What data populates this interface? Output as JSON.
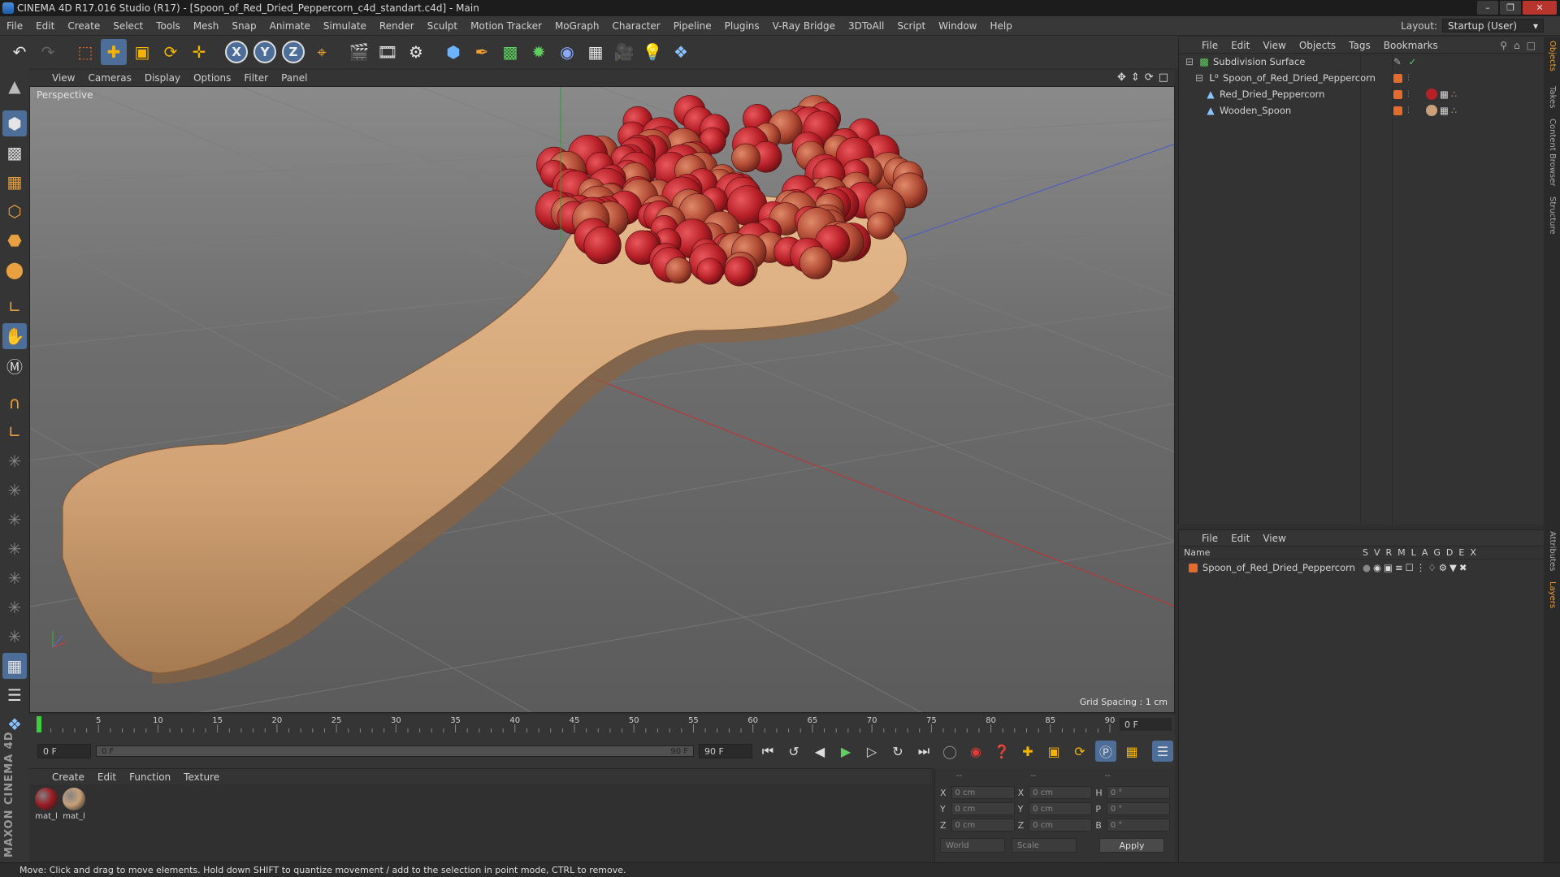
{
  "window": {
    "title": "CINEMA 4D R17.016 Studio (R17) - [Spoon_of_Red_Dried_Peppercorn_c4d_standart.c4d] - Main"
  },
  "menubar": {
    "items": [
      "File",
      "Edit",
      "Create",
      "Select",
      "Tools",
      "Mesh",
      "Snap",
      "Animate",
      "Simulate",
      "Render",
      "Sculpt",
      "Motion Tracker",
      "MoGraph",
      "Character",
      "Pipeline",
      "Plugins",
      "V-Ray Bridge",
      "3DToAll",
      "Script",
      "Window",
      "Help"
    ],
    "layout_label": "Layout:",
    "layout_value": "Startup (User)"
  },
  "toolbar": {
    "axis_x": "X",
    "axis_y": "Y",
    "axis_z": "Z"
  },
  "viewport": {
    "menu": [
      "View",
      "Cameras",
      "Display",
      "Options",
      "Filter",
      "Panel"
    ],
    "camera_label": "Perspective",
    "grid_spacing": "Grid Spacing : 1 cm",
    "colors": {
      "spoon": "#d4a578",
      "peppercorn": "#c42a30",
      "grid_bg": "#6e6e6e"
    }
  },
  "timeline": {
    "ticks": [
      "0",
      "5",
      "10",
      "15",
      "20",
      "25",
      "30",
      "35",
      "40",
      "45",
      "50",
      "55",
      "60",
      "65",
      "70",
      "75",
      "80",
      "85",
      "90"
    ],
    "current_frame": "0 F"
  },
  "playbar": {
    "start_field": "0 F",
    "slider_start": "0 F",
    "slider_end": "90 F",
    "end_field": "90 F"
  },
  "materials": {
    "menu": [
      "Create",
      "Edit",
      "Function",
      "Texture"
    ],
    "items": [
      {
        "label": "mat_l",
        "color": "#9a1c22"
      },
      {
        "label": "mat_l",
        "color": "#c9a07a"
      }
    ]
  },
  "coordinates": {
    "header": [
      "--",
      "--",
      "--"
    ],
    "rows": [
      {
        "a1": "X",
        "v1": "0 cm",
        "a2": "X",
        "v2": "0 cm",
        "a3": "H",
        "v3": "0 °"
      },
      {
        "a1": "Y",
        "v1": "0 cm",
        "a2": "Y",
        "v2": "0 cm",
        "a3": "P",
        "v3": "0 °"
      },
      {
        "a1": "Z",
        "v1": "0 cm",
        "a2": "Z",
        "v2": "0 cm",
        "a3": "B",
        "v3": "0 °"
      }
    ],
    "mode": "World",
    "transform": "Scale",
    "apply_label": "Apply"
  },
  "objects_panel": {
    "menu": [
      "File",
      "Edit",
      "View",
      "Objects",
      "Tags",
      "Bookmarks"
    ],
    "objects": [
      {
        "name": "Subdivision Surface",
        "indent": 0
      },
      {
        "name": "Spoon_of_Red_Dried_Peppercorn",
        "indent": 1
      },
      {
        "name": "Red_Dried_Peppercorn",
        "indent": 2
      },
      {
        "name": "Wooden_Spoon",
        "indent": 2
      }
    ]
  },
  "layers_panel": {
    "menu": [
      "File",
      "Edit",
      "View"
    ],
    "name_header": "Name",
    "columns": [
      "S",
      "V",
      "R",
      "M",
      "L",
      "A",
      "G",
      "D",
      "E",
      "X"
    ],
    "layers": [
      {
        "name": "Spoon_of_Red_Dried_Peppercorn"
      }
    ]
  },
  "side_tabs": [
    "Objects",
    "Takes",
    "Content Browser",
    "Structure",
    "Attributes",
    "Layers"
  ],
  "branding": "MAXON CINEMA 4D",
  "status": "Move: Click and drag to move elements. Hold down SHIFT to quantize movement / add to the selection in point mode, CTRL to remove."
}
